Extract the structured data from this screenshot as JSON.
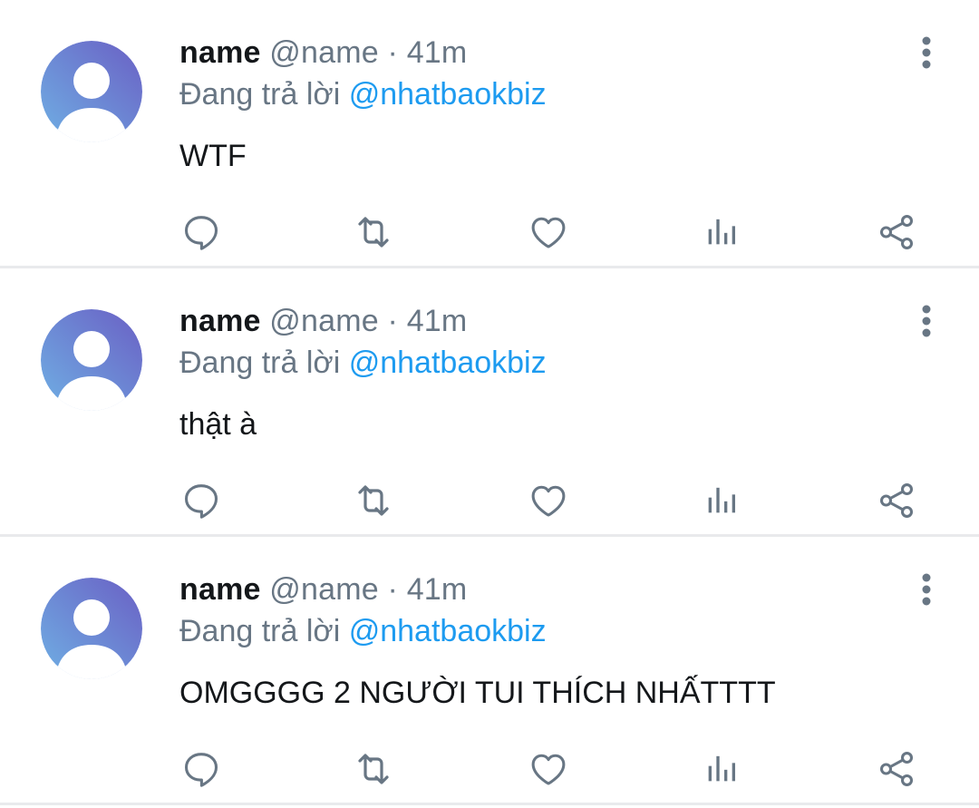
{
  "tweets": [
    {
      "display_name": "name",
      "handle": "@name",
      "separator": "·",
      "time": "41m",
      "reply_prefix": "Đang trả lời",
      "reply_to": "@nhatbaokbiz",
      "text": "WTF"
    },
    {
      "display_name": "name",
      "handle": "@name",
      "separator": "·",
      "time": "41m",
      "reply_prefix": "Đang trả lời",
      "reply_to": "@nhatbaokbiz",
      "text": "thật à"
    },
    {
      "display_name": "name",
      "handle": "@name",
      "separator": "·",
      "time": "41m",
      "reply_prefix": "Đang trả lời",
      "reply_to": "@nhatbaokbiz",
      "text": "OMGGGG 2 NGƯỜI TUI THÍCH NHẤTTTT"
    }
  ],
  "icons": {
    "avatar": "default-avatar-icon",
    "more": "more-vertical-icon",
    "reply": "reply-icon",
    "retweet": "retweet-icon",
    "like": "heart-icon",
    "views": "analytics-icon",
    "share": "share-icon"
  },
  "colors": {
    "text_primary": "#14171a",
    "text_secondary": "#687684",
    "link": "#1d9bf0",
    "icon": "#687684",
    "avatar_gradient_start": "#6fb0e4",
    "avatar_gradient_end": "#6a5fc4",
    "divider": "#e9eaec"
  }
}
